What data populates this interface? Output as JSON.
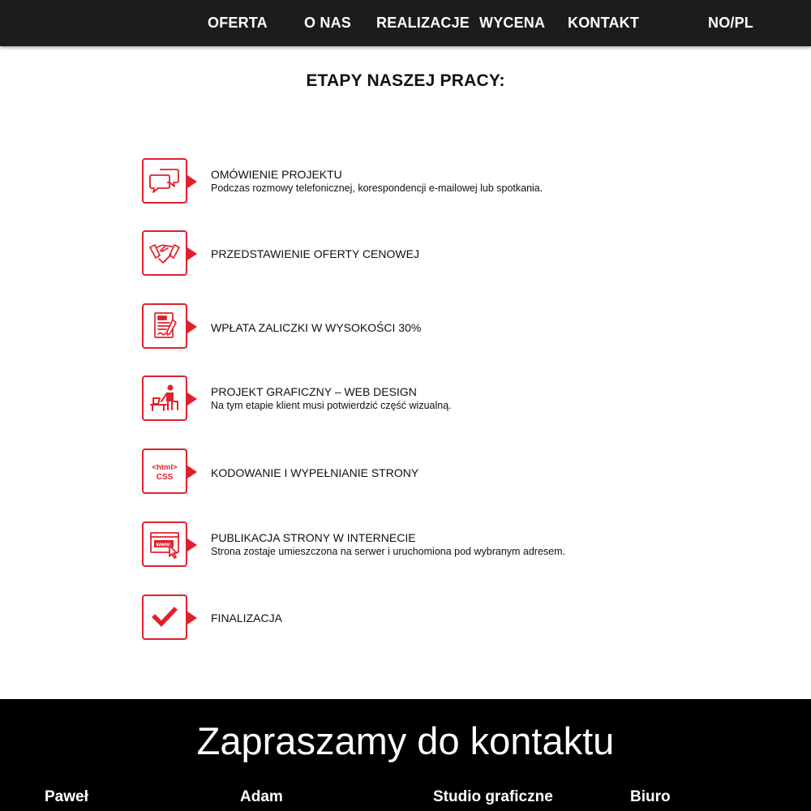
{
  "nav": {
    "items": [
      {
        "id": "oferta",
        "label": "OFERTA"
      },
      {
        "id": "o-nas",
        "label": "O NAS"
      },
      {
        "id": "realizacje",
        "label": "REALIZACJE"
      },
      {
        "id": "wycena",
        "label": "WYCENA"
      },
      {
        "id": "kontakt",
        "label": "KONTAKT"
      }
    ],
    "language_label": "NO/PL"
  },
  "main": {
    "title": "ETAPY NASZEJ PRACY:",
    "steps": [
      {
        "icon": "chat-bubbles-icon",
        "title": "OMÓWIENIE PROJEKTU",
        "description": "Podczas rozmowy telefonicznej, korespondencji e-mailowej lub spotkania."
      },
      {
        "icon": "handshake-icon",
        "title": "PRZEDSTAWIENIE OFERTY CENOWEJ",
        "description": ""
      },
      {
        "icon": "contract-document-icon",
        "title": "WPŁATA ZALICZKI W WYSOKOŚCI 30%",
        "description": ""
      },
      {
        "icon": "designer-at-desk-icon",
        "title": "PROJEKT GRAFICZNY – WEB DESIGN",
        "description": "Na tym etapie klient musi potwierdzić część wizualną."
      },
      {
        "icon": "html-css-icon",
        "icon_text": [
          "<html>",
          "CSS"
        ],
        "title": "KODOWANIE I WYPEŁNIANIE STRONY",
        "description": ""
      },
      {
        "icon": "www-browser-icon",
        "icon_text": [
          "www."
        ],
        "title": "PUBLIKACJA STRONY W INTERNECIE",
        "description": "Strona zostaje umieszczona na serwer i uruchomiona pod wybranym adresem."
      },
      {
        "icon": "checkmark-icon",
        "title": "FINALIZACJA",
        "description": ""
      }
    ]
  },
  "footer": {
    "title": "Zapraszamy do kontaktu",
    "columns": [
      "Paweł",
      "Adam",
      "Studio graficzne",
      "Biuro"
    ]
  },
  "colors": {
    "accent": "#e0202e",
    "nav_bg": "#1c1c1c",
    "footer_bg": "#000000"
  }
}
